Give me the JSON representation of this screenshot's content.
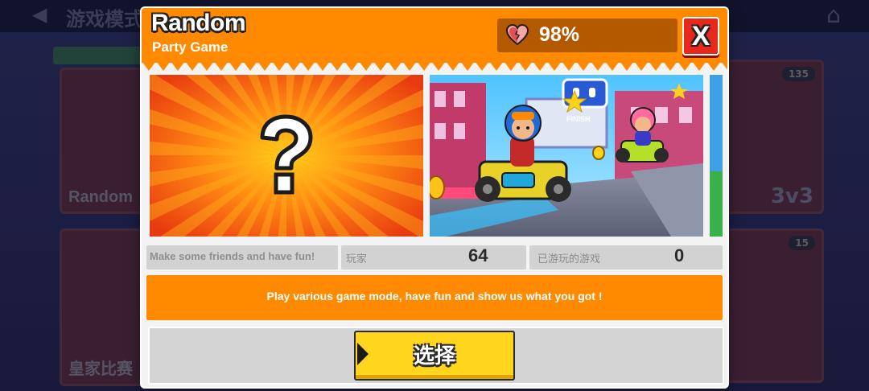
{
  "background": {
    "title": "游戏模式",
    "cards": [
      {
        "label": "Random"
      },
      {
        "label": "皇家比赛"
      }
    ],
    "right_cards": [
      {
        "badge": "135",
        "mode": "3v3"
      },
      {
        "badge": "15"
      }
    ]
  },
  "modal": {
    "title": "Random",
    "subtitle": "Party Game",
    "health": {
      "value": "98%",
      "icon": "heart-icon"
    },
    "close_label": "X",
    "images": [
      {
        "name": "random-question-mark",
        "glyph": "?"
      },
      {
        "name": "kart-racing-preview",
        "sign": "FINISH"
      }
    ],
    "info": {
      "tagline": "Make some friends and have fun!",
      "players_label": "玩家",
      "players_value": "64",
      "played_label": "已游玩的游戏",
      "played_value": "0"
    },
    "description": "Play various game mode, have fun and show us what you got !",
    "select_label": "选择"
  },
  "colors": {
    "header": "#ff8a00",
    "close": "#e8281c",
    "select": "#ffd51e",
    "health_bg": "#b35a00"
  }
}
